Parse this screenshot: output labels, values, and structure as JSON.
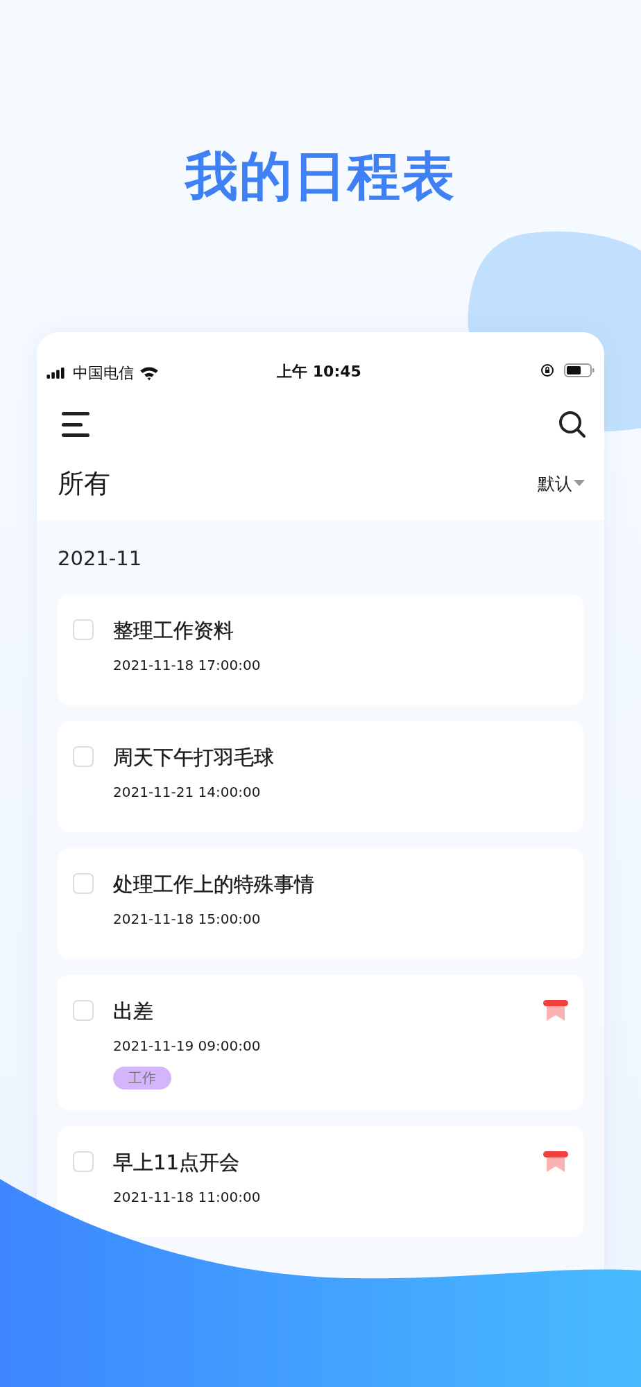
{
  "headline": "我的日程表",
  "status_bar": {
    "carrier": "中国电信",
    "time": "上午 10:45"
  },
  "header": {
    "title": "所有",
    "sort": "默认"
  },
  "month": "2021-11",
  "tasks": [
    {
      "title": "整理工作资料",
      "time": "2021-11-18 17:00:00",
      "checked": false,
      "flagged": false
    },
    {
      "title": "周天下午打羽毛球",
      "time": "2021-11-21 14:00:00",
      "checked": false,
      "flagged": false
    },
    {
      "title": "处理工作上的特殊事情",
      "time": "2021-11-18 15:00:00",
      "checked": false,
      "flagged": false
    },
    {
      "title": "出差",
      "time": "2021-11-19 09:00:00",
      "checked": false,
      "flagged": true,
      "tag": {
        "label": "工作",
        "color": "#d4b5fb"
      }
    },
    {
      "title": "早上11点开会",
      "time": "2021-11-18 11:00:00",
      "checked": false,
      "flagged": true
    }
  ]
}
